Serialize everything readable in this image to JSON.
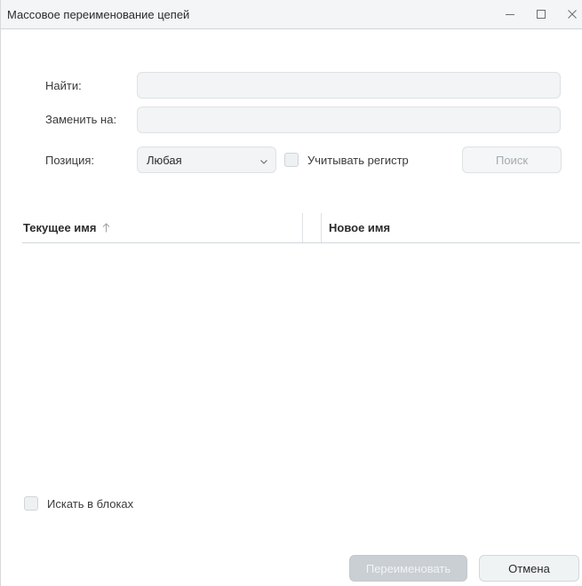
{
  "window": {
    "title": "Массовое переименование цепей"
  },
  "form": {
    "find_label": "Найти:",
    "find_value": "",
    "replace_label": "Заменить на:",
    "replace_value": "",
    "position_label": "Позиция:",
    "position_value": "Любая",
    "match_case_label": "Учитывать регистр",
    "match_case_checked": false,
    "search_button": "Поиск"
  },
  "table": {
    "columns": [
      {
        "label": "Текущее имя",
        "sort": "ascending"
      },
      {
        "label": "Новое имя"
      }
    ],
    "rows": []
  },
  "footer": {
    "search_in_blocks_label": "Искать в блоках",
    "search_in_blocks_checked": false,
    "rename_button": "Переименовать",
    "cancel_button": "Отмена"
  },
  "icons": {
    "minimize": "minimize-icon",
    "maximize": "maximize-icon",
    "close": "close-icon",
    "sort": "arrow-up-icon",
    "dropdown": "chevron-down-icon"
  }
}
